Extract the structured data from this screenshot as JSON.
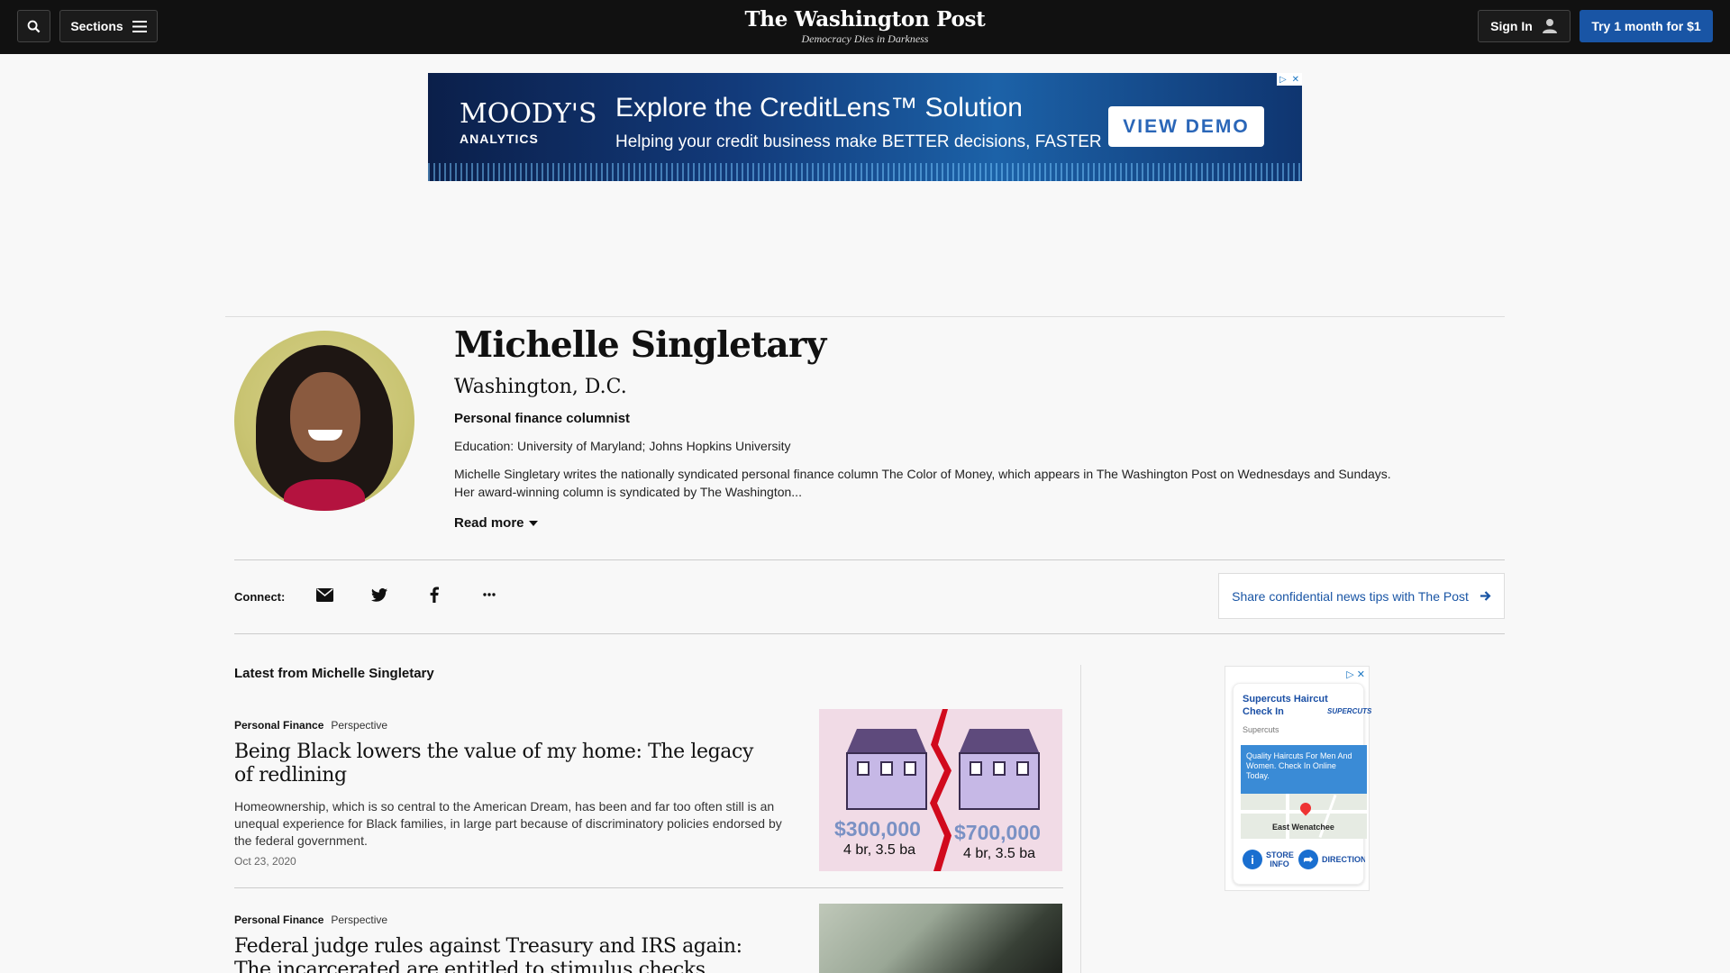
{
  "header": {
    "logo_title": "The Washington Post",
    "logo_tagline": "Democracy Dies in Darkness",
    "sections_label": "Sections",
    "sign_in_label": "Sign In",
    "subscribe_label": "Try 1 month for $1"
  },
  "banner_ad": {
    "brand": "MOODY'S",
    "brand_sub": "ANALYTICS",
    "headline": "Explore the CreditLens™ Solution",
    "subline": "Helping your credit business make BETTER decisions, FASTER",
    "cta": "VIEW DEMO"
  },
  "author": {
    "name": "Michelle Singletary",
    "location": "Washington, D.C.",
    "title": "Personal finance columnist",
    "education": "Education: University of Maryland; Johns Hopkins University",
    "bio": "Michelle Singletary writes the nationally syndicated personal finance column The Color of Money, which appears in The Washington Post on Wednesdays and Sundays. Her award-winning column is syndicated by The Washington...",
    "read_more": "Read more"
  },
  "connect": {
    "label": "Connect:",
    "icons": [
      "mail-icon",
      "twitter-icon",
      "facebook-icon",
      "more-icon"
    ],
    "tips_label": "Share confidential news tips with The Post"
  },
  "latest": {
    "heading": "Latest from Michelle Singletary",
    "articles": [
      {
        "section": "Personal Finance",
        "label": "Perspective",
        "headline": "Being Black lowers the value of my home: The legacy of redlining",
        "blurb": "Homeownership, which is so central to the American Dream, has been and far too often still is an unequal experience for Black families, in large part because of discriminatory policies endorsed by the federal government.",
        "date": "Oct 23, 2020",
        "image_text": {
          "price_left": "$300,000",
          "spec_left": "4 br, 3.5 ba",
          "price_right": "$700,000",
          "spec_right": "4 br, 3.5 ba"
        }
      },
      {
        "section": "Personal Finance",
        "label": "Perspective",
        "headline": "Federal judge rules against Treasury and IRS again: The incarcerated are entitled to stimulus checks"
      }
    ]
  },
  "side_ad": {
    "title": "Supercuts Haircut Check In",
    "brand": "SUPERCUTS",
    "source": "Supercuts",
    "promo": "Quality Haircuts For Men And Women. Check In Online Today.",
    "map_town": "East Wenatchee",
    "store_info": "STORE INFO",
    "directions": "DIRECTIONS"
  },
  "colors": {
    "nav_bg": "#111111",
    "accent_blue": "#1955a5",
    "page_bg": "#f8f8f8"
  }
}
